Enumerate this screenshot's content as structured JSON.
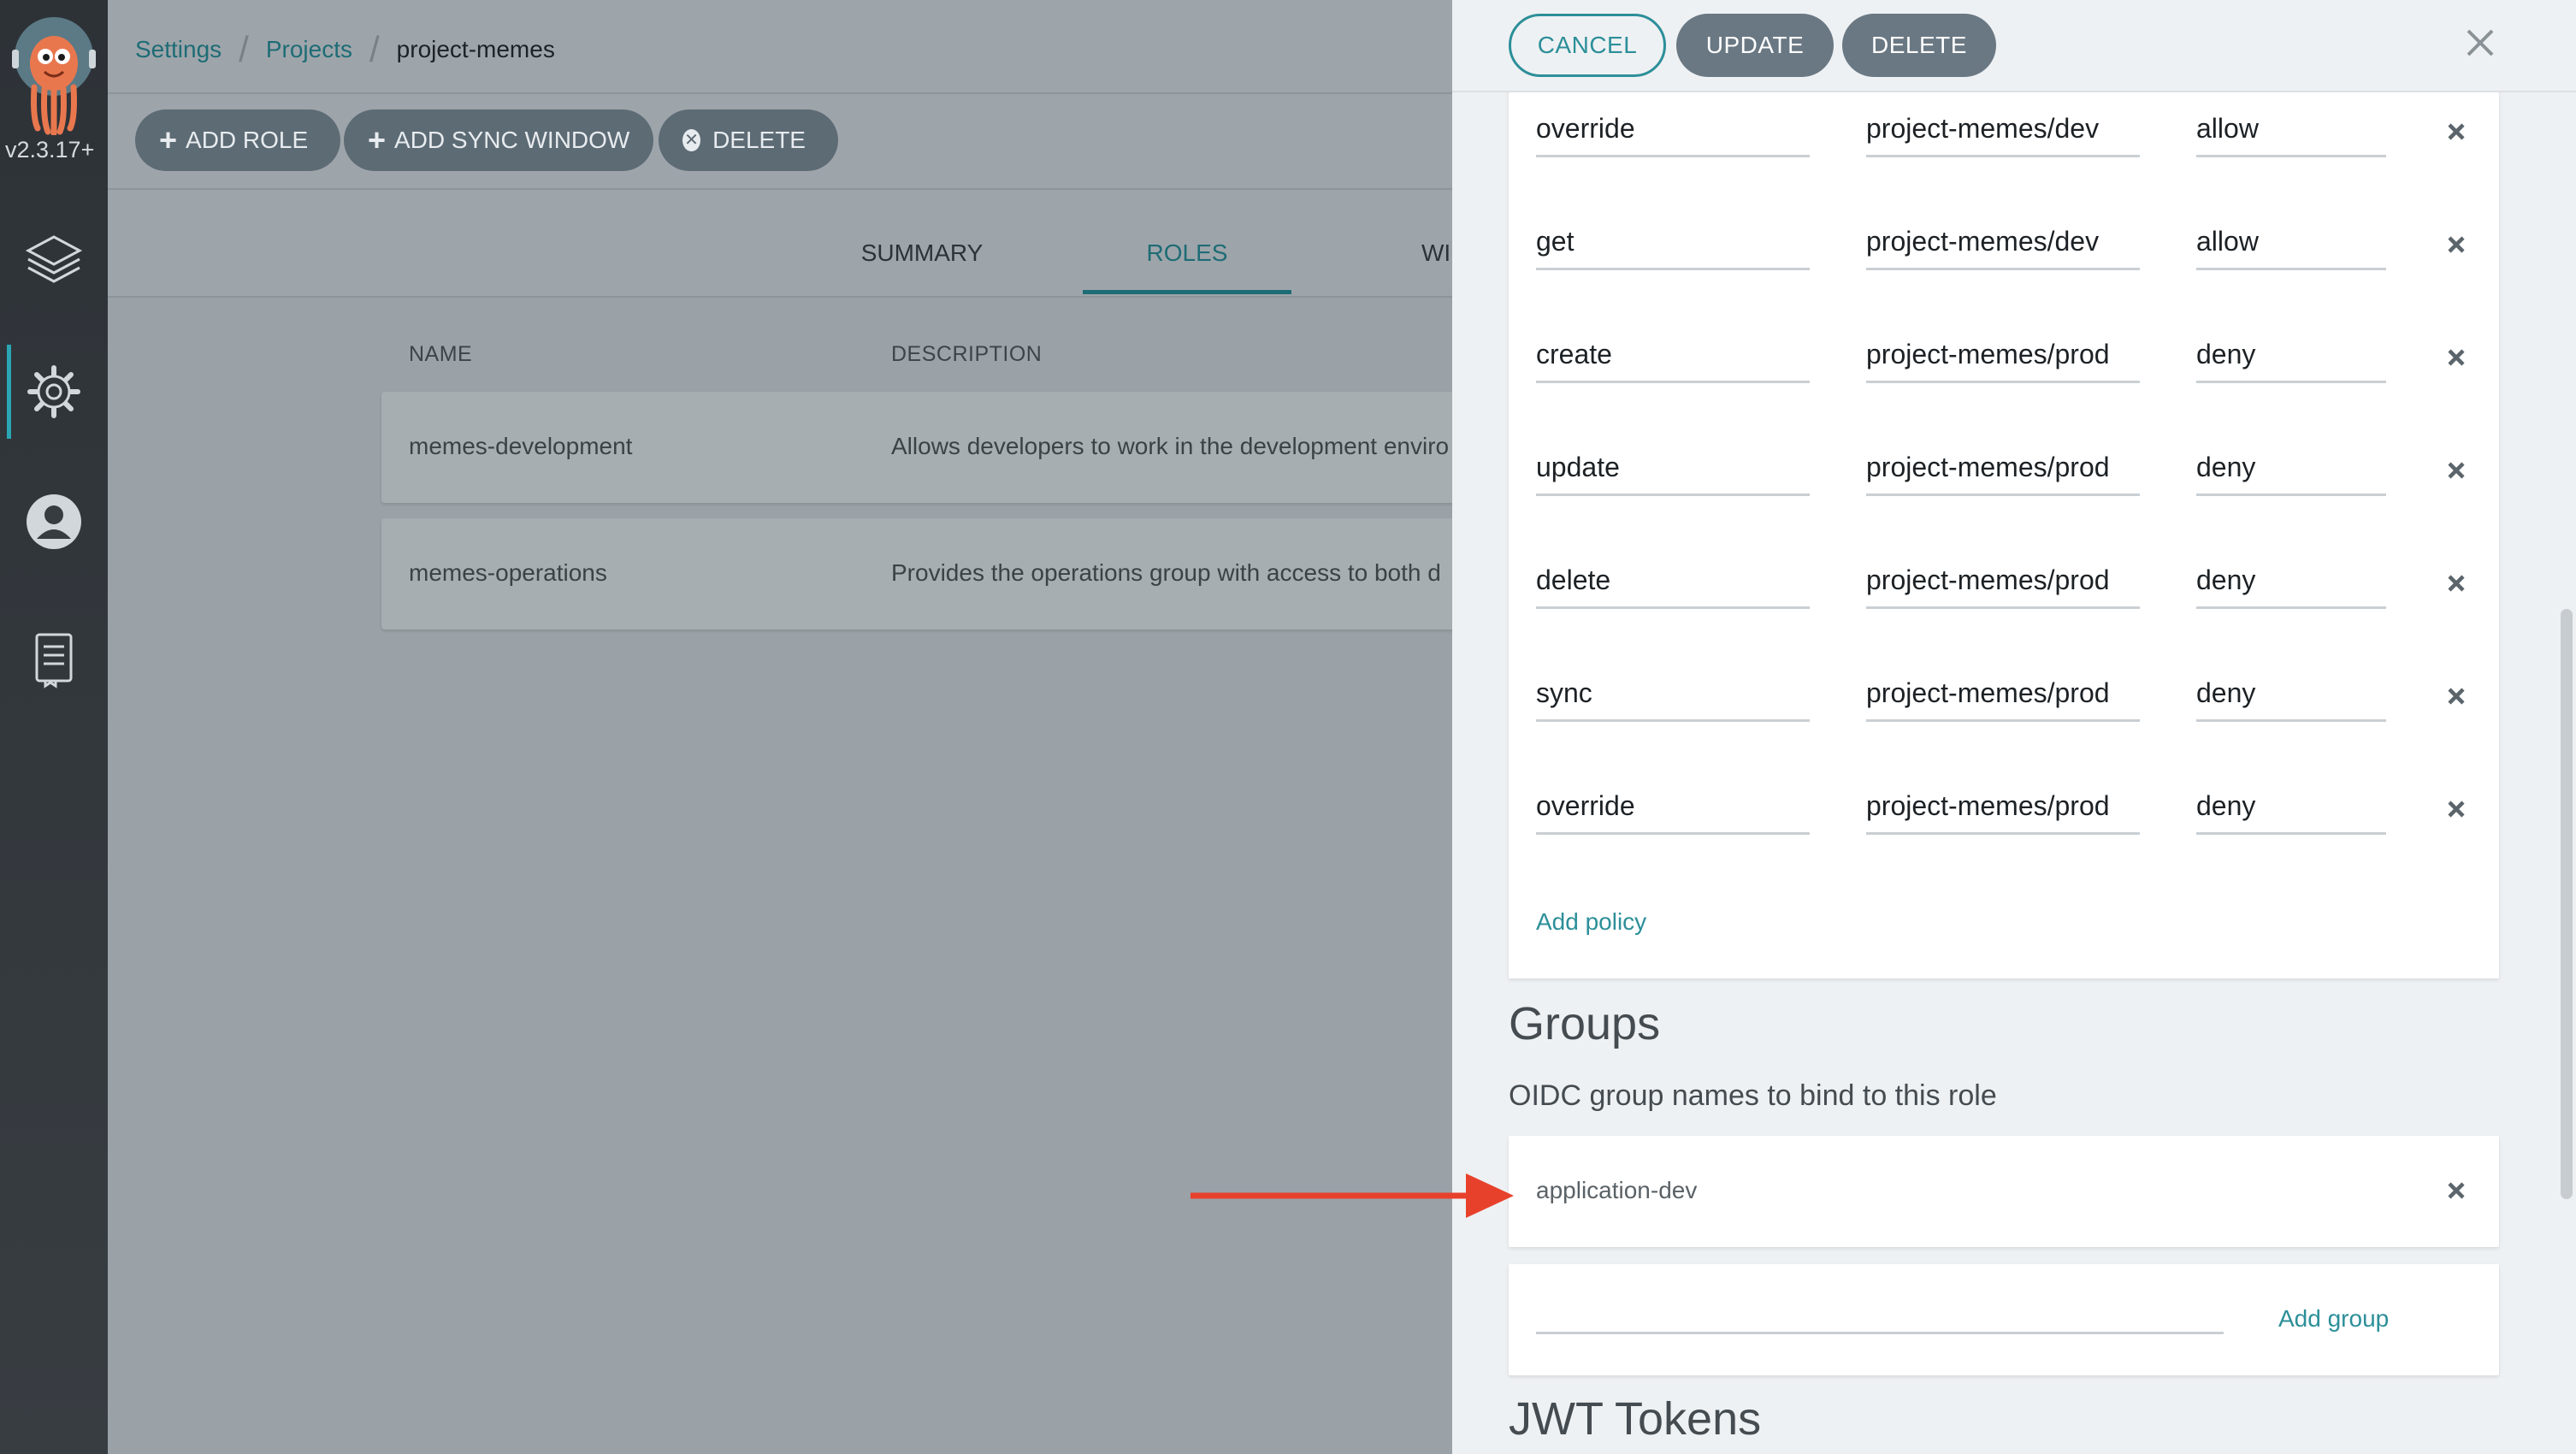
{
  "nav": {
    "version": "v2.3.17+",
    "items": [
      "layers-icon",
      "gear-icon",
      "user-icon",
      "docs-icon"
    ]
  },
  "breadcrumb": {
    "settings": "Settings",
    "projects": "Projects",
    "current": "project-memes"
  },
  "toolbar": {
    "add_role": "ADD ROLE",
    "add_sync_window": "ADD SYNC WINDOW",
    "delete": "DELETE"
  },
  "tabs": {
    "summary": "SUMMARY",
    "roles": "ROLES",
    "windows": "WI"
  },
  "roles_table": {
    "headers": {
      "name": "NAME",
      "description": "DESCRIPTION"
    },
    "rows": [
      {
        "name": "memes-development",
        "description": "Allows developers to work in the development enviro"
      },
      {
        "name": "memes-operations",
        "description": "Provides the operations group with access to both d"
      }
    ]
  },
  "drawer": {
    "cancel": "CANCEL",
    "update": "UPDATE",
    "delete": "DELETE",
    "policies": [
      {
        "action": "override",
        "object": "project-memes/dev",
        "permission": "allow"
      },
      {
        "action": "get",
        "object": "project-memes/dev",
        "permission": "allow"
      },
      {
        "action": "create",
        "object": "project-memes/prod",
        "permission": "deny"
      },
      {
        "action": "update",
        "object": "project-memes/prod",
        "permission": "deny"
      },
      {
        "action": "delete",
        "object": "project-memes/prod",
        "permission": "deny"
      },
      {
        "action": "sync",
        "object": "project-memes/prod",
        "permission": "deny"
      },
      {
        "action": "override",
        "object": "project-memes/prod",
        "permission": "deny"
      }
    ],
    "add_policy": "Add policy",
    "groups_title": "Groups",
    "groups_subtitle": "OIDC group names to bind to this role",
    "groups": [
      "application-dev"
    ],
    "add_group": "Add group",
    "new_group_value": "",
    "jwt_title": "JWT Tokens"
  },
  "colors": {
    "accent": "#2c8f99",
    "annotation_arrow": "#e8412b",
    "button_gray": "#6a7883"
  }
}
